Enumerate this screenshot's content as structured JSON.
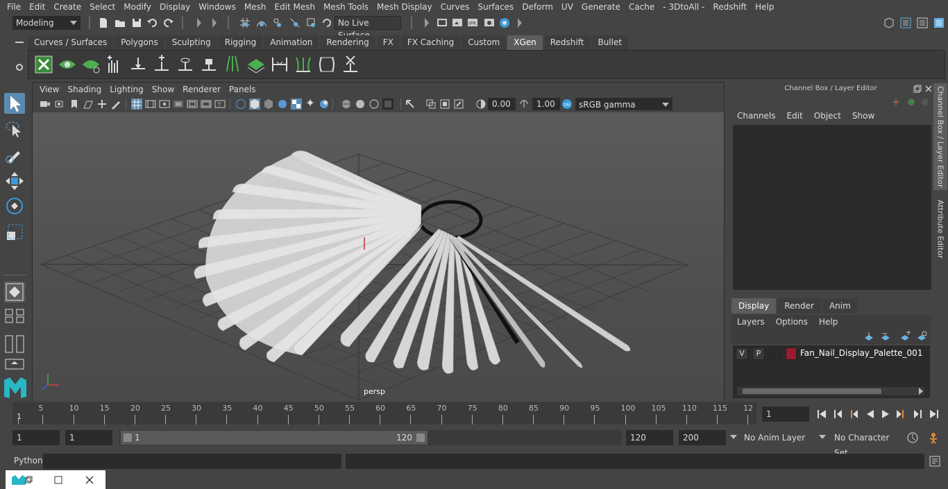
{
  "menubar": [
    "File",
    "Edit",
    "Create",
    "Select",
    "Modify",
    "Display",
    "Windows",
    "Mesh",
    "Edit Mesh",
    "Mesh Tools",
    "Mesh Display",
    "Curves",
    "Surfaces",
    "Deform",
    "UV",
    "Generate",
    "Cache",
    "- 3DtoAll -",
    "Redshift",
    "Help"
  ],
  "status": {
    "mode": "Modeling",
    "live_surface": "No Live Surface"
  },
  "shelf": {
    "tabs": [
      "Curves / Surfaces",
      "Polygons",
      "Sculpting",
      "Rigging",
      "Animation",
      "Rendering",
      "FX",
      "FX Caching",
      "Custom",
      "XGen",
      "Redshift",
      "Bullet"
    ],
    "active": "XGen"
  },
  "viewport": {
    "menu": [
      "View",
      "Shading",
      "Lighting",
      "Show",
      "Renderer",
      "Panels"
    ],
    "exposure": "0.00",
    "gamma": "1.00",
    "colorspace": "sRGB gamma",
    "camera": "persp"
  },
  "channelbox": {
    "title": "Channel Box / Layer Editor",
    "menu": [
      "Channels",
      "Edit",
      "Object",
      "Show"
    ]
  },
  "layereditor": {
    "tabs": [
      "Display",
      "Render",
      "Anim"
    ],
    "active": "Display",
    "menu": [
      "Layers",
      "Options",
      "Help"
    ],
    "layer": {
      "v": "V",
      "p": "P",
      "name": "Fan_Nail_Display_Palette_001",
      "color": "#9b1b30"
    }
  },
  "sidetabs": [
    "Channel Box / Layer Editor",
    "Attribute Editor"
  ],
  "timeline": {
    "labels": [
      "5",
      "10",
      "15",
      "20",
      "25",
      "30",
      "35",
      "40",
      "45",
      "50",
      "55",
      "60",
      "65",
      "70",
      "75",
      "80",
      "85",
      "90",
      "95",
      "100",
      "105",
      "110",
      "115",
      "12"
    ],
    "start_marker": "1",
    "current_frame": "1"
  },
  "range": {
    "start": "1",
    "playback_start": "1",
    "slider_start": "1",
    "slider_end": "120",
    "playback_end": "120",
    "end": "200",
    "anim_layer": "No Anim Layer",
    "character_set": "No Character Set"
  },
  "commandline": {
    "label": "Python"
  }
}
